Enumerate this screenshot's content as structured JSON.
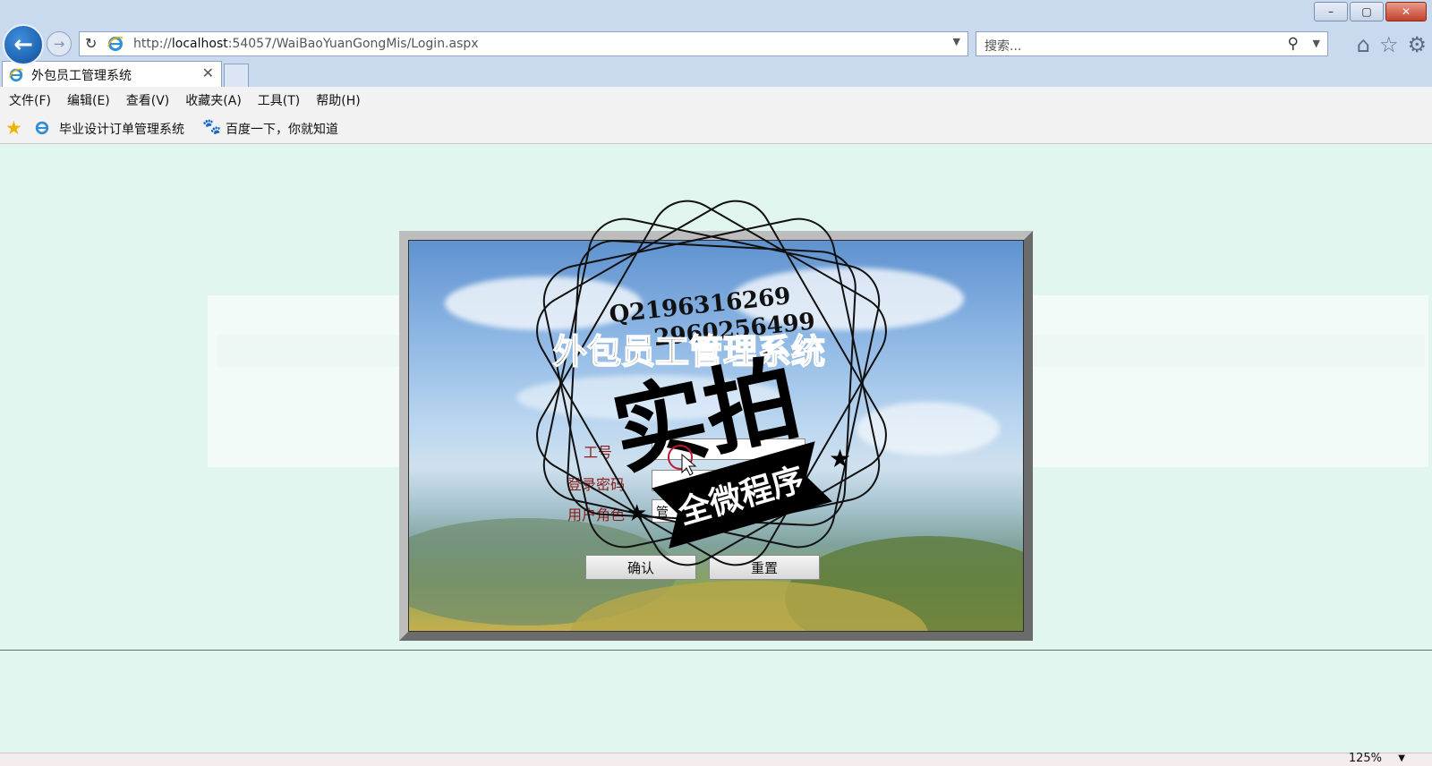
{
  "window": {
    "minimize": "–",
    "restore": "▢",
    "close": "✕"
  },
  "nav": {
    "back_icon": "back-arrow-icon",
    "forward_icon": "forward-arrow-icon",
    "address": {
      "url_prefix": "http://",
      "url_host": "localhost",
      "url_rest": ":54057/WaiBaoYuanGongMis/Login.aspx"
    },
    "search_placeholder": "搜索..."
  },
  "tab": {
    "title": "外包员工管理系统",
    "close": "✕"
  },
  "menu": [
    "文件(F)",
    "编辑(E)",
    "查看(V)",
    "收藏夹(A)",
    "工具(T)",
    "帮助(H)"
  ],
  "favorites": [
    "毕业设计订单管理系统",
    "百度一下，你就知道"
  ],
  "login": {
    "title": "外包员工管理系统",
    "employee_id_label": "工号",
    "password_label": "登录密码",
    "role_label": "用户角色",
    "role_value": "管",
    "confirm_label": "确认",
    "reset_label": "重置"
  },
  "watermark": {
    "qq1": "Q2196316269",
    "qq2": "2960256499",
    "big_text": "实拍",
    "banner": "全微程序"
  },
  "status": {
    "zoom": "125%"
  }
}
